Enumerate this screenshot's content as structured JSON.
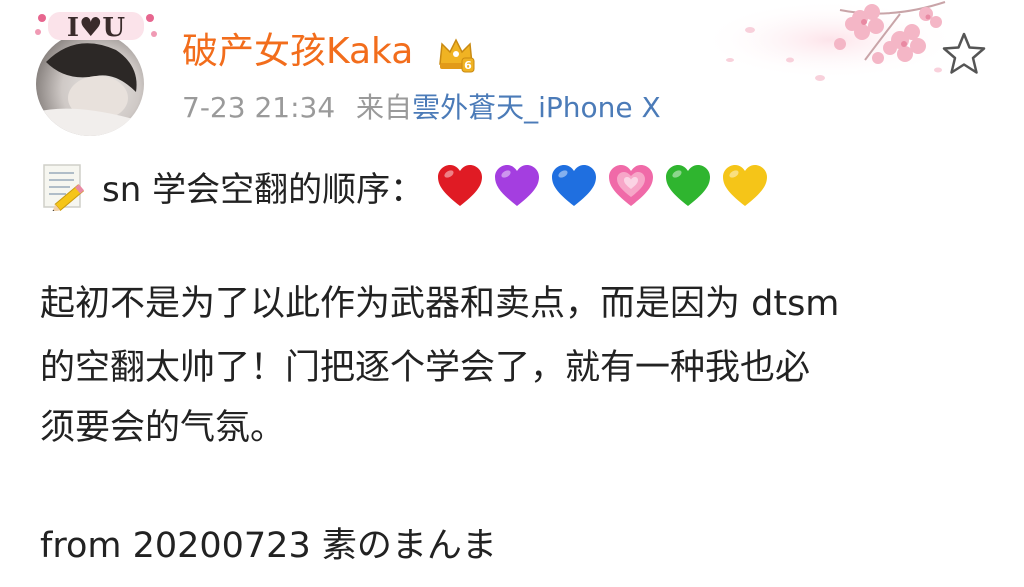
{
  "post": {
    "avatar_badge_text": "I♥U",
    "username": "破产女孩Kaka",
    "crown_level": "6",
    "timestamp": "7-23 21:34",
    "source_prefix": "来自",
    "source": "雲外蒼天_iPhone X",
    "title": "sn 学会空翻的顺序：",
    "hearts": [
      "red-heart",
      "purple-heart",
      "blue-heart",
      "pink-heart",
      "green-heart",
      "yellow-heart"
    ],
    "heart_colors": [
      "#e01b24",
      "#a43ee0",
      "#1f6fe0",
      "#f06aa8",
      "#2fb52f",
      "#f5c518"
    ],
    "body_line_1": "起初不是为了以此作为武器和卖点，而是因为 dtsm",
    "body_line_2": "的空翻太帅了！门把逐个学会了，就有一种我也必",
    "body_line_3": "须要会的气氛。",
    "footer": "from 20200723 素のまんま"
  },
  "colors": {
    "username": "#f26d1c",
    "source_link": "#4b7bb8",
    "meta": "#9a9a9a",
    "text": "#222222"
  }
}
